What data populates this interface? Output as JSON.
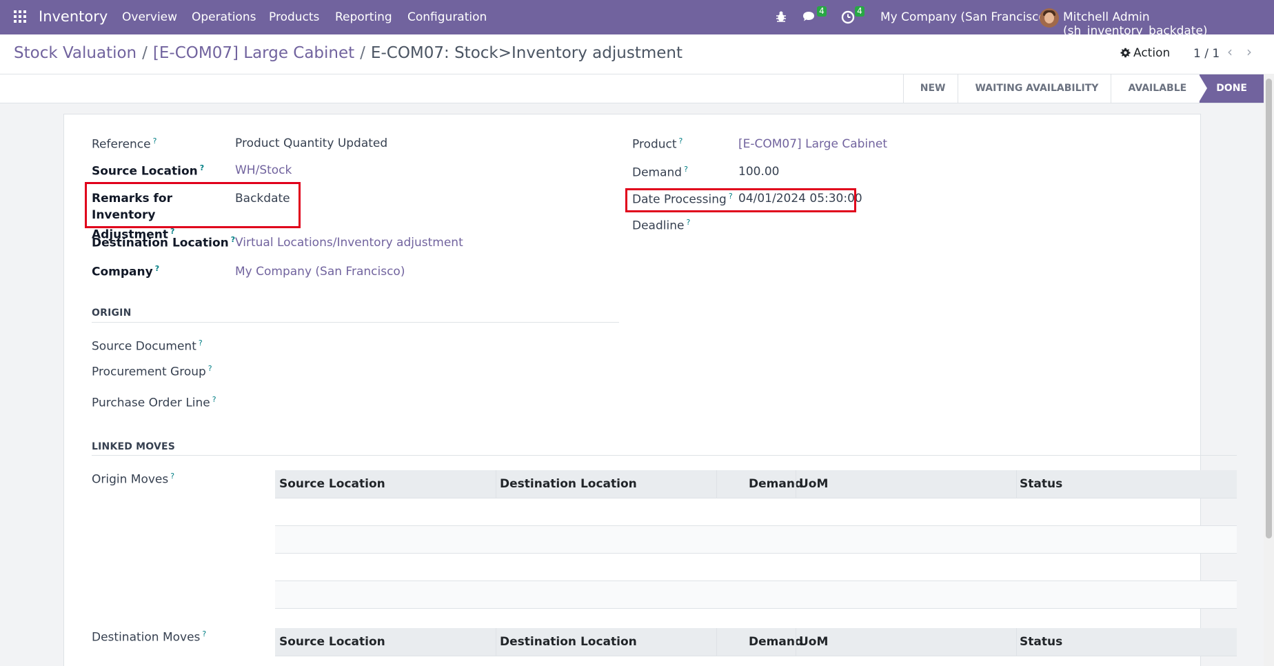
{
  "navbar": {
    "app_name": "Inventory",
    "menu": [
      "Overview",
      "Operations",
      "Products",
      "Reporting",
      "Configuration"
    ],
    "messages_count": "4",
    "activities_count": "4",
    "company": "My Company (San Francisco)",
    "user": "Mitchell Admin (sh_inventory_backdate)",
    "brand_color": "#71639e"
  },
  "breadcrumb": {
    "crumb1": "Stock Valuation",
    "crumb2": "[E-COM07] Large Cabinet",
    "separator": "/",
    "current": "E-COM07: Stock>Inventory adjustment"
  },
  "control": {
    "action_label": "Action",
    "pager": "1 / 1"
  },
  "statusbar": {
    "steps": [
      "NEW",
      "WAITING AVAILABILITY",
      "AVAILABLE",
      "DONE"
    ],
    "active_step": "DONE"
  },
  "form": {
    "left": {
      "reference": {
        "label": "Reference",
        "value": "Product Quantity Updated"
      },
      "source_location": {
        "label": "Source Location",
        "value": "WH/Stock"
      },
      "remarks": {
        "label": "Remarks for Inventory Adjustment",
        "value": "Backdate"
      },
      "destination_location": {
        "label": "Destination Location",
        "value": "Virtual Locations/Inventory adjustment"
      },
      "company": {
        "label": "Company",
        "value": "My Company (San Francisco)"
      }
    },
    "right": {
      "product": {
        "label": "Product",
        "value": "[E-COM07] Large Cabinet"
      },
      "demand": {
        "label": "Demand",
        "value": "100.00"
      },
      "date_processing": {
        "label": "Date Processing",
        "value": "04/01/2024 05:30:00"
      },
      "deadline": {
        "label": "Deadline",
        "value": ""
      }
    },
    "origin_section": {
      "title": "ORIGIN",
      "source_document": "Source Document",
      "procurement_group": "Procurement Group",
      "purchase_order_line": "Purchase Order Line"
    },
    "linked_moves_section": {
      "title": "LINKED MOVES",
      "origin_moves_label": "Origin Moves",
      "destination_moves_label": "Destination Moves",
      "columns": [
        "Source Location",
        "Destination Location",
        "Demand",
        "UoM",
        "Status"
      ]
    },
    "help_mark": "?"
  },
  "highlight_color": "#e0001b"
}
